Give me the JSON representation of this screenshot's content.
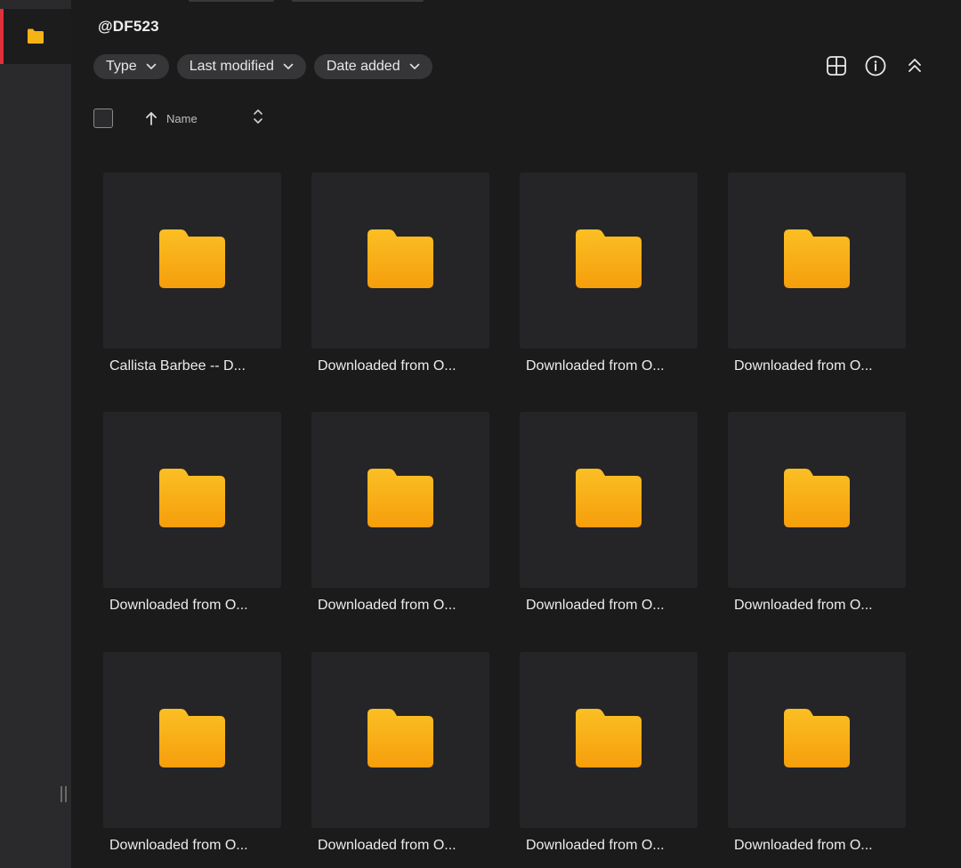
{
  "location": {
    "title": "@DF523"
  },
  "filters": [
    {
      "label": "Type"
    },
    {
      "label": "Last modified"
    },
    {
      "label": "Date added"
    }
  ],
  "toolbar": {
    "icons": [
      "grid-view-icon",
      "info-icon",
      "collapse-icon"
    ]
  },
  "sort": {
    "column_label": "Name",
    "direction": "ascending"
  },
  "items": [
    {
      "name": "Callista Barbee -- D..."
    },
    {
      "name": "Downloaded from O..."
    },
    {
      "name": "Downloaded from O..."
    },
    {
      "name": "Downloaded from O..."
    },
    {
      "name": "Downloaded from O..."
    },
    {
      "name": "Downloaded from O..."
    },
    {
      "name": "Downloaded from O..."
    },
    {
      "name": "Downloaded from O..."
    },
    {
      "name": "Downloaded from O..."
    },
    {
      "name": "Downloaded from O..."
    },
    {
      "name": "Downloaded from O..."
    },
    {
      "name": "Downloaded from O..."
    }
  ],
  "colors": {
    "background": "#1b1b1c",
    "tile": "#252527",
    "accent": "#e0303a",
    "folder": "#fbbf24"
  }
}
